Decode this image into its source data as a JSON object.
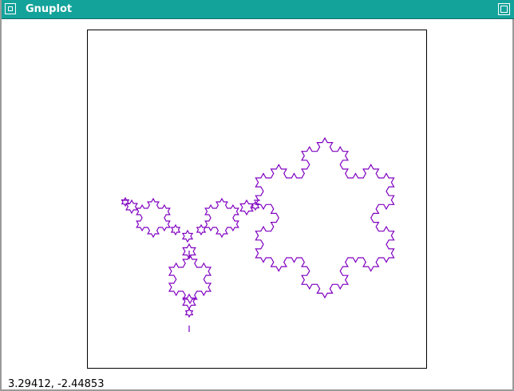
{
  "window": {
    "title": "Gnuplot",
    "menu_icon": "window-menu-icon",
    "maximize_icon": "maximize-icon",
    "titlebar_color": "#14a39a"
  },
  "plot": {
    "border_color": "#000000",
    "curve_color": "#8000c0",
    "curve_description": "Koch-snowflake fractal curves"
  },
  "status": {
    "coordinate_readout": "3.29412, -2.44853"
  }
}
